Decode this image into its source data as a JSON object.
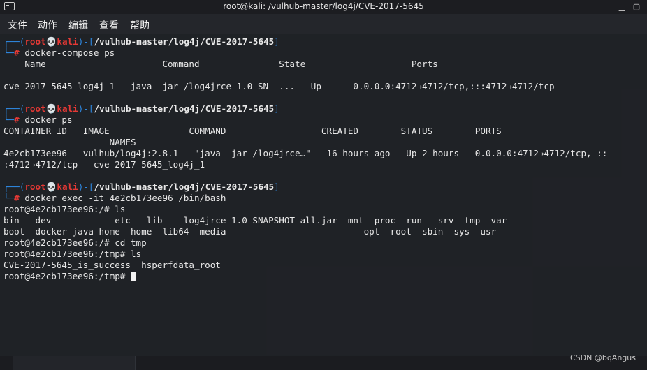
{
  "window": {
    "title": "root@kali: /vulhub-master/log4j/CVE-2017-5645"
  },
  "menubar": {
    "items": [
      "文件",
      "动作",
      "编辑",
      "查看",
      "帮助"
    ]
  },
  "terminal": {
    "prompt": {
      "open": "┌──(",
      "user": "root",
      "skull": "💀",
      "host": "kali",
      "close": ")-[",
      "path": "/vulhub-master/log4j/CVE-2017-5645",
      "end": "]",
      "corner": "└─",
      "hash": "#"
    },
    "cmd1": " docker-compose ps",
    "compose_header": "    Name                      Command               State                    Ports",
    "compose_row": "cve-2017-5645_log4j_1   java -jar /log4jrce-1.0-SN  ...   Up      0.0.0.0:4712→4712/tcp,:::4712→4712/tcp",
    "cmd2": " docker ps",
    "ps_header": "CONTAINER ID   IMAGE               COMMAND                  CREATED        STATUS        PORTS",
    "ps_header2": "                    NAMES",
    "ps_row": "4e2cb173ee96   vulhub/log4j:2.8.1   \"java -jar /log4jrce…\"   16 hours ago   Up 2 hours   0.0.0.0:4712→4712/tcp, ::",
    "ps_row2": ":4712→4712/tcp   cve-2017-5645_log4j_1",
    "cmd3": " docker exec -it 4e2cb173ee96 /bin/bash",
    "l_ls": "root@4e2cb173ee96:/# ls",
    "ls1": "bin   dev            etc   lib    log4jrce-1.0-SNAPSHOT-all.jar  mnt  proc  run   srv  tmp  var",
    "ls2": "boot  docker-java-home  home  lib64  media                          opt  root  sbin  sys  usr",
    "l_cd": "root@4e2cb173ee96:/# cd tmp",
    "l_ls2": "root@4e2cb173ee96:/tmp# ls",
    "ls3": "CVE-2017-5645_is_success  hsperfdata_root",
    "l_last": "root@4e2cb173ee96:/tmp# "
  },
  "watermark": "CSDN @bqAngus",
  "colors": {
    "prompt_blue": "#2e86de",
    "prompt_red": "#e53935",
    "bg": "#1d1f24"
  }
}
